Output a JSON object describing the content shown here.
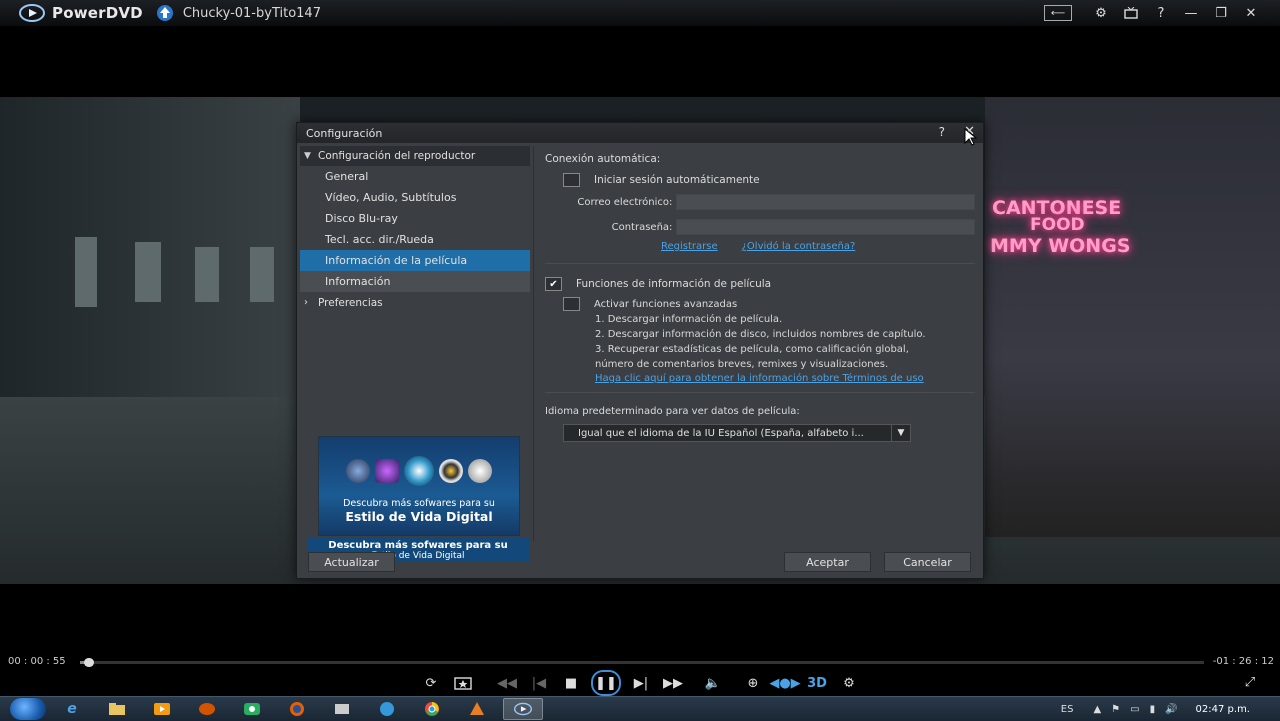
{
  "window": {
    "app_name": "PowerDVD",
    "file_name": "Chucky-01-byTito147"
  },
  "title_buttons": {
    "help": "?"
  },
  "scene": {
    "neon_line1": "CANTONESE",
    "neon_line2": "FOOD",
    "neon_line3": "MMY WONGS"
  },
  "dialog": {
    "title": "Configuración",
    "help": "?",
    "sidebar": {
      "header": "Configuración del reproductor",
      "items": [
        "General",
        "Vídeo, Audio, Subtítulos",
        "Disco Blu-ray",
        "Tecl. acc. dir./Rueda",
        "Información de la película",
        "Información"
      ],
      "preferences": "Preferencias",
      "promo_text1": "Descubra más sofwares para su",
      "promo_text2": "Estilo de Vida Digital",
      "promo_bar_line1": "Descubra más sofwares para su",
      "promo_bar_line2": "Estilo de Vida Digital"
    },
    "content": {
      "auto_connect_label": "Conexión automática:",
      "auto_login_label": "Iniciar sesión automáticamente",
      "auto_login_checked": false,
      "email_label": "Correo electrónico:",
      "email_value": "",
      "password_label": "Contraseña:",
      "password_value": "",
      "register_link": "Registrarse",
      "forgot_link": "¿Olvidó la contraseña?",
      "movie_info_label": "Funciones de información de película",
      "movie_info_checked": true,
      "advanced_label": "Activar funciones avanzadas",
      "advanced_checked": false,
      "line1": "1. Descargar información de película.",
      "line2": "2. Descargar información de disco, incluidos nombres de capítulo.",
      "line3": "3. Recuperar estadísticas de película, como calificación global,",
      "line4": "número de comentarios breves, remixes y visualizaciones.",
      "terms_link": "Haga clic aquí para obtener la información sobre Términos de uso",
      "language_label": "Idioma predeterminado para ver datos de película:",
      "language_value": "Igual que el idioma de la IU Español (España, alfabeto i..."
    },
    "buttons": {
      "update": "Actualizar",
      "accept": "Aceptar",
      "cancel": "Cancelar"
    }
  },
  "player": {
    "elapsed": "00 : 00 : 55",
    "remaining": "-01 : 26 : 12",
    "progress_fraction": 0.006,
    "three_d_label": "3D"
  },
  "taskbar": {
    "language": "ES",
    "clock": "02:47 p.m."
  },
  "colors": {
    "accent": "#1f6ea8",
    "link": "#4aa3e6"
  }
}
